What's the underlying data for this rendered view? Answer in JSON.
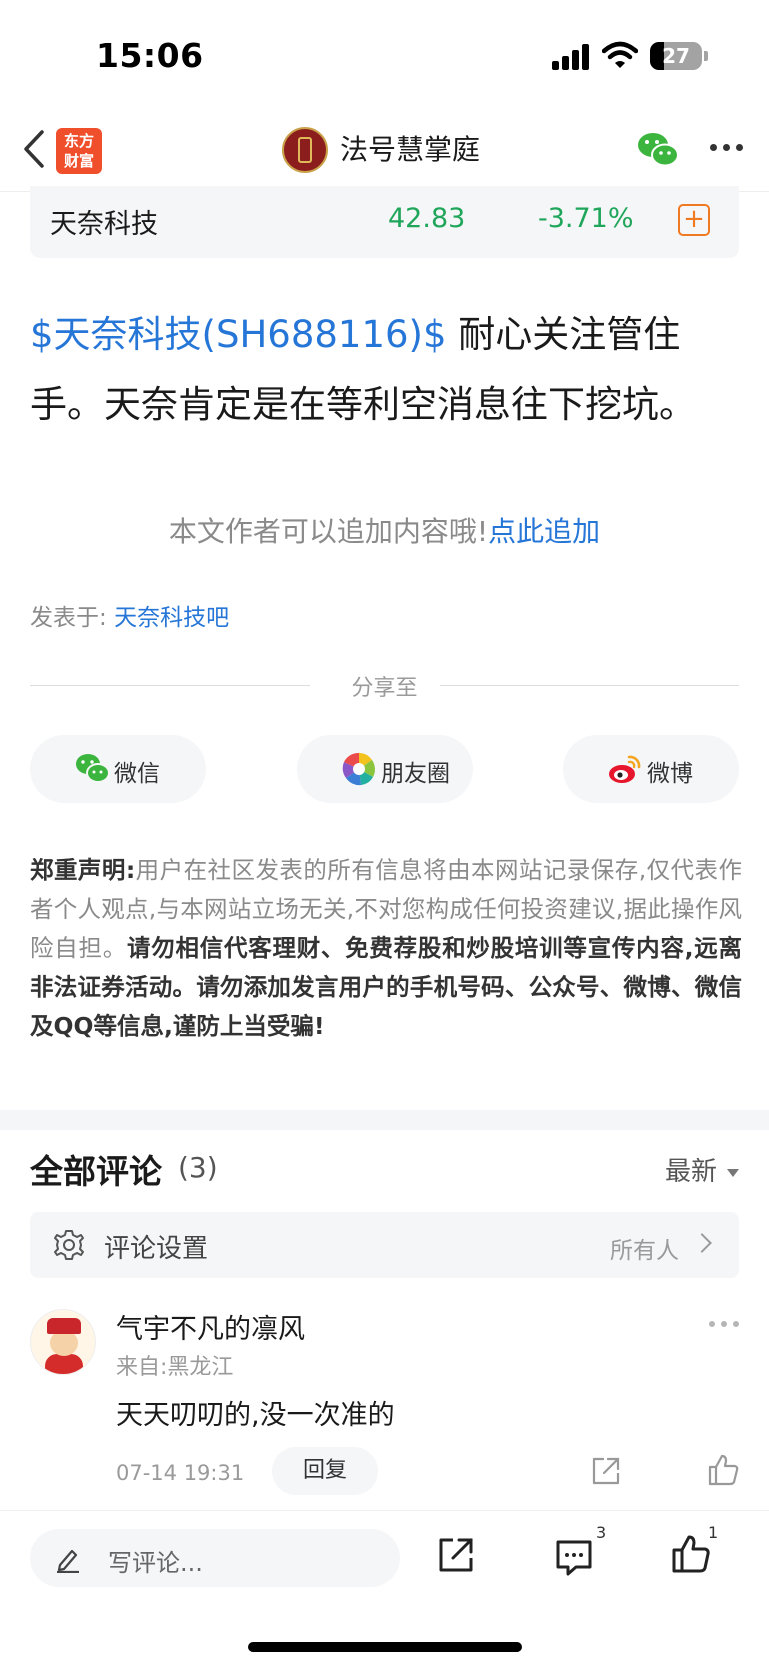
{
  "status_bar": {
    "time": "15:06",
    "battery": "27"
  },
  "nav": {
    "app_logo": "东方财富",
    "account_name": "法号慧掌庭"
  },
  "stock": {
    "name": "天奈科技",
    "price": "42.83",
    "change": "-3.71%",
    "add_symbol": "+"
  },
  "post": {
    "stock_link": "$天奈科技(SH688116)$",
    "text": " 耐心关注管住手。天奈肯定是在等利空消息往下挖坑。"
  },
  "append": {
    "prompt": "本文作者可以追加内容哦!",
    "link": "点此追加"
  },
  "posted_in": {
    "label": "发表于: ",
    "forum": "天奈科技吧"
  },
  "share": {
    "title": "分享至",
    "buttons": [
      {
        "label": "微信",
        "icon": "wechat-icon"
      },
      {
        "label": "朋友圈",
        "icon": "moments-icon"
      },
      {
        "label": "微博",
        "icon": "weibo-icon"
      }
    ]
  },
  "disclaimer": {
    "heading": "郑重声明:",
    "normal": "用户在社区发表的所有信息将由本网站记录保存,仅代表作者个人观点,与本网站立场无关,不对您构成任何投资建议,据此操作风险自担。",
    "bold": "请勿相信代客理财、免费荐股和炒股培训等宣传内容,远离非法证券活动。请勿添加发言用户的手机号码、公众号、微博、微信及QQ等信息,谨防上当受骗!"
  },
  "comments": {
    "title": "全部评论",
    "count": "(3)",
    "sort": "最新",
    "settings_label": "评论设置",
    "settings_value": "所有人",
    "items": [
      {
        "author": "气宇不凡的凛风",
        "location": "来自:黑龙江",
        "text": "天天叨叨的,没一次准的",
        "time": "07-14 19:31",
        "reply_label": "回复"
      }
    ]
  },
  "bottom_bar": {
    "placeholder": "写评论...",
    "comment_count": "3",
    "like_count": "1"
  },
  "colors": {
    "link": "#2676d8",
    "stock_down": "#1fa65a",
    "accent": "#f07a22",
    "brand": "#f04f2b"
  }
}
